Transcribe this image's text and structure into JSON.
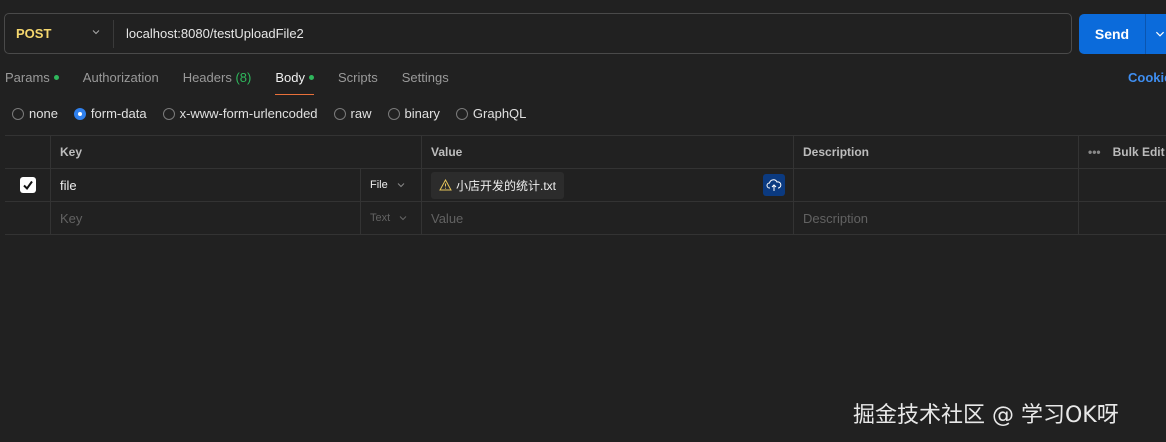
{
  "request": {
    "method": "POST",
    "url": "localhost:8080/testUploadFile2",
    "send_label": "Send"
  },
  "tabs": [
    {
      "label": "Params",
      "dot": true
    },
    {
      "label": "Authorization"
    },
    {
      "label": "Headers",
      "count": "(8)"
    },
    {
      "label": "Body",
      "dot": true,
      "active": true
    },
    {
      "label": "Scripts"
    },
    {
      "label": "Settings"
    }
  ],
  "cookies_label": "Cookies",
  "body_types": [
    {
      "label": "none"
    },
    {
      "label": "form-data",
      "selected": true
    },
    {
      "label": "x-www-form-urlencoded"
    },
    {
      "label": "raw"
    },
    {
      "label": "binary"
    },
    {
      "label": "GraphQL"
    }
  ],
  "table": {
    "headers": {
      "key": "Key",
      "value": "Value",
      "description": "Description",
      "bulk_edit": "Bulk Edit"
    },
    "rows": [
      {
        "checked": true,
        "key": "file",
        "type": "File",
        "value": "小店开发的统计.txt",
        "value_icon": "warning-icon"
      }
    ],
    "empty_row": {
      "key": "Key",
      "type": "Text",
      "value": "Value",
      "description": "Description"
    }
  },
  "colors": {
    "accent": "#0b6bdb",
    "method": "#f5d76e",
    "active_tab": "#e8703a",
    "dot": "#2fb75c"
  },
  "watermark": "掘金技术社区 @ 学习OK呀"
}
